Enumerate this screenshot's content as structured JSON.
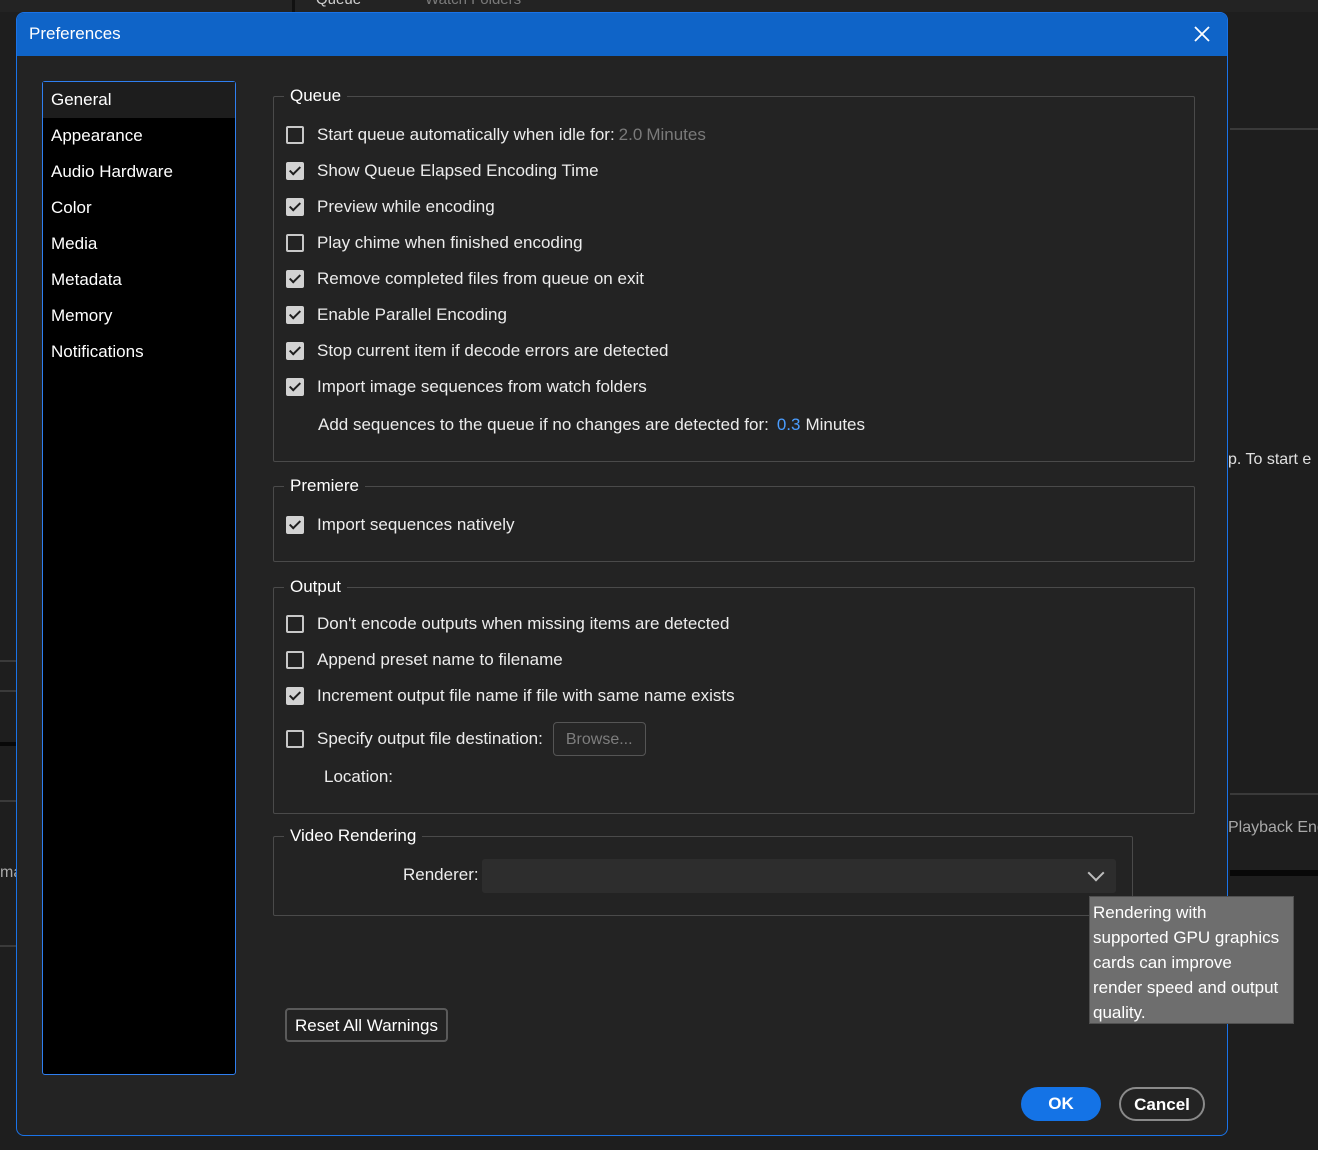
{
  "background": {
    "top_tab_1": "Queue",
    "top_tab_2": "Watch Folders",
    "right_text_1": "p.  To start e",
    "right_text_2": "Playback Eng",
    "left_text": "ma"
  },
  "dialog": {
    "title": "Preferences",
    "close_icon": "close-icon"
  },
  "sidebar": {
    "items": [
      {
        "label": "General",
        "active": true
      },
      {
        "label": "Appearance"
      },
      {
        "label": "Audio Hardware"
      },
      {
        "label": "Color"
      },
      {
        "label": "Media"
      },
      {
        "label": "Metadata"
      },
      {
        "label": "Memory"
      },
      {
        "label": "Notifications"
      }
    ]
  },
  "queue": {
    "legend": "Queue",
    "start_auto": {
      "label": "Start queue automatically when idle for:",
      "value": "2.0",
      "unit": "Minutes",
      "checked": false
    },
    "show_elapsed": {
      "label": "Show Queue Elapsed Encoding Time",
      "checked": true
    },
    "preview": {
      "label": "Preview while encoding",
      "checked": true
    },
    "chime": {
      "label": "Play chime when finished encoding",
      "checked": false
    },
    "remove_completed": {
      "label": "Remove completed files from queue on exit",
      "checked": true
    },
    "parallel": {
      "label": "Enable Parallel Encoding",
      "checked": true
    },
    "stop_decode": {
      "label": "Stop current item if decode errors are detected",
      "checked": true
    },
    "import_seq": {
      "label": "Import image sequences from watch folders",
      "checked": true
    },
    "add_seq": {
      "label": "Add sequences to the queue if no changes are detected for:",
      "value": "0.3",
      "unit": "Minutes"
    }
  },
  "premiere": {
    "legend": "Premiere",
    "import_native": {
      "label": "Import sequences natively",
      "checked": true
    }
  },
  "output": {
    "legend": "Output",
    "dont_encode": {
      "label": "Don't encode outputs when missing items are detected",
      "checked": false
    },
    "append_preset": {
      "label": "Append preset name to filename",
      "checked": false
    },
    "increment": {
      "label": "Increment output file name if file with same name exists",
      "checked": true
    },
    "specify_dest": {
      "label": "Specify output file destination:",
      "checked": false
    },
    "browse_label": "Browse...",
    "location_label": "Location:"
  },
  "video_rendering": {
    "legend": "Video Rendering",
    "renderer_label": "Renderer:",
    "renderer_value": ""
  },
  "tooltip": {
    "lines": [
      "Rendering with",
      "supported GPU graphics",
      "cards can improve",
      "render speed and output",
      "quality."
    ]
  },
  "buttons": {
    "reset": "Reset All Warnings",
    "ok": "OK",
    "cancel": "Cancel"
  },
  "colors": {
    "accent": "#1473e6",
    "titlebar": "#0f64c8",
    "value_blue": "#4a9dff"
  }
}
